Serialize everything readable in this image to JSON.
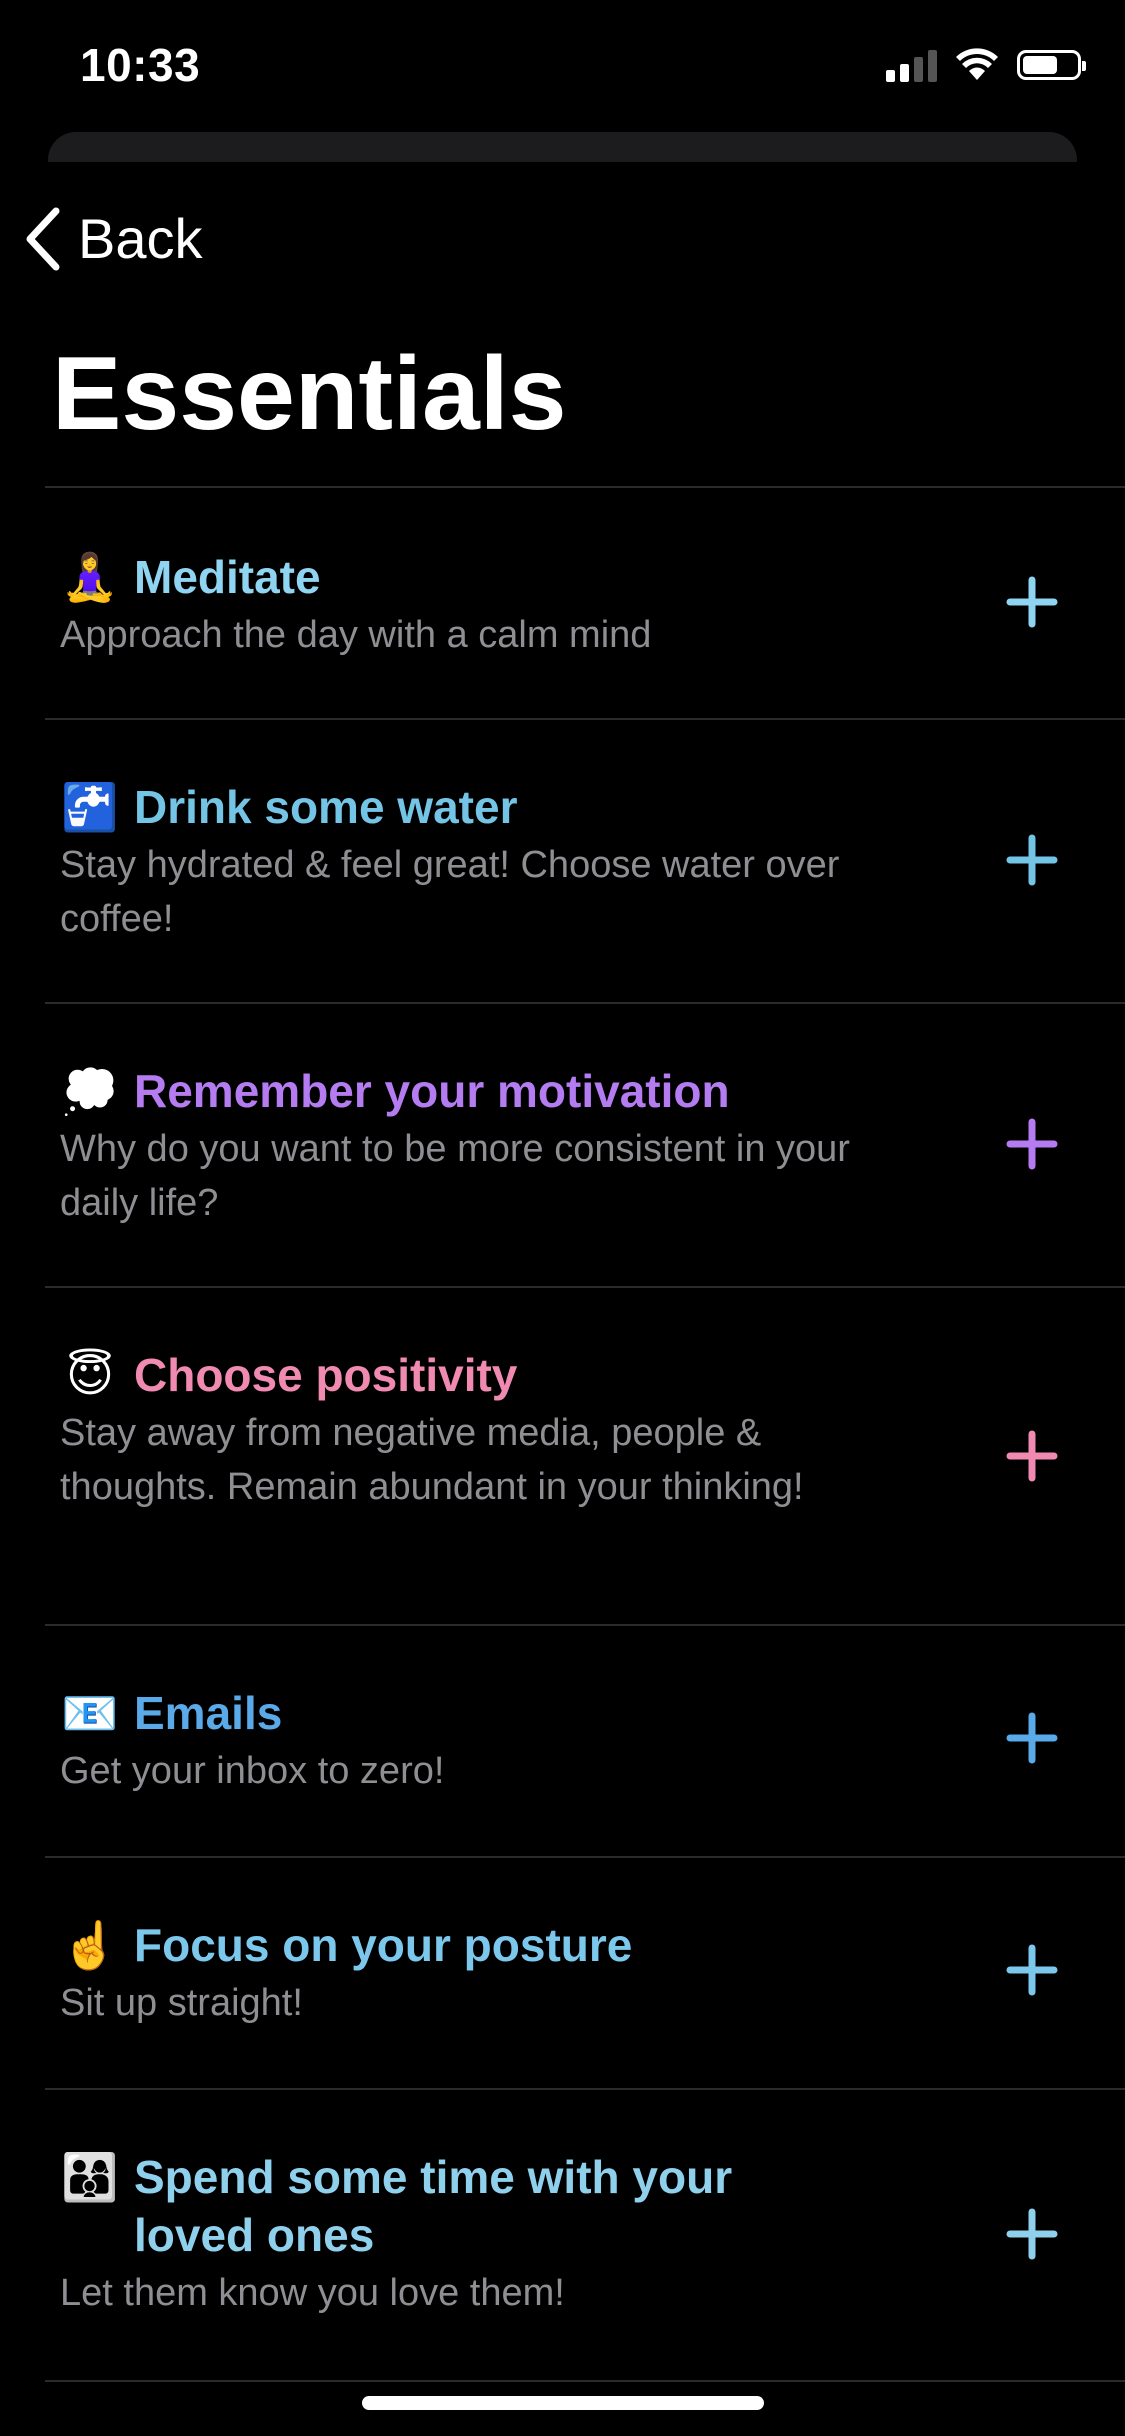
{
  "status_bar": {
    "time": "10:33",
    "battery_level": 0.6,
    "signal_bars": 2
  },
  "nav": {
    "back_label": "Back"
  },
  "page_title": "Essentials",
  "items": [
    {
      "emoji": "🧘‍♀️",
      "title": "Meditate",
      "description": "Approach the day with a calm mind",
      "color": "#8fd4f0"
    },
    {
      "emoji": "🚰",
      "title": "Drink some water",
      "description": "Stay hydrated & feel great! Choose water over coffee!",
      "color": "#74c4e6"
    },
    {
      "emoji": "💭",
      "title": "Remember your motivation",
      "description": "Why do you want to be more consistent in your daily life?",
      "color": "#b57cf2"
    },
    {
      "emoji": "😇",
      "title": "Choose positivity",
      "description": "Stay away from negative media, people & thoughts. Remain abundant in your thinking!",
      "color": "#f08ab0"
    },
    {
      "emoji": "📧",
      "title": "Emails",
      "description": "Get your inbox to zero!",
      "color": "#5aa9e8"
    },
    {
      "emoji": "☝️",
      "title": "Focus on your posture",
      "description": "Sit up straight!",
      "color": "#7cc8ec"
    },
    {
      "emoji": "👨‍👩‍👦",
      "title": "Spend some time with your loved ones",
      "description": "Let them know you love them!",
      "color": "#8fd0ec"
    }
  ]
}
